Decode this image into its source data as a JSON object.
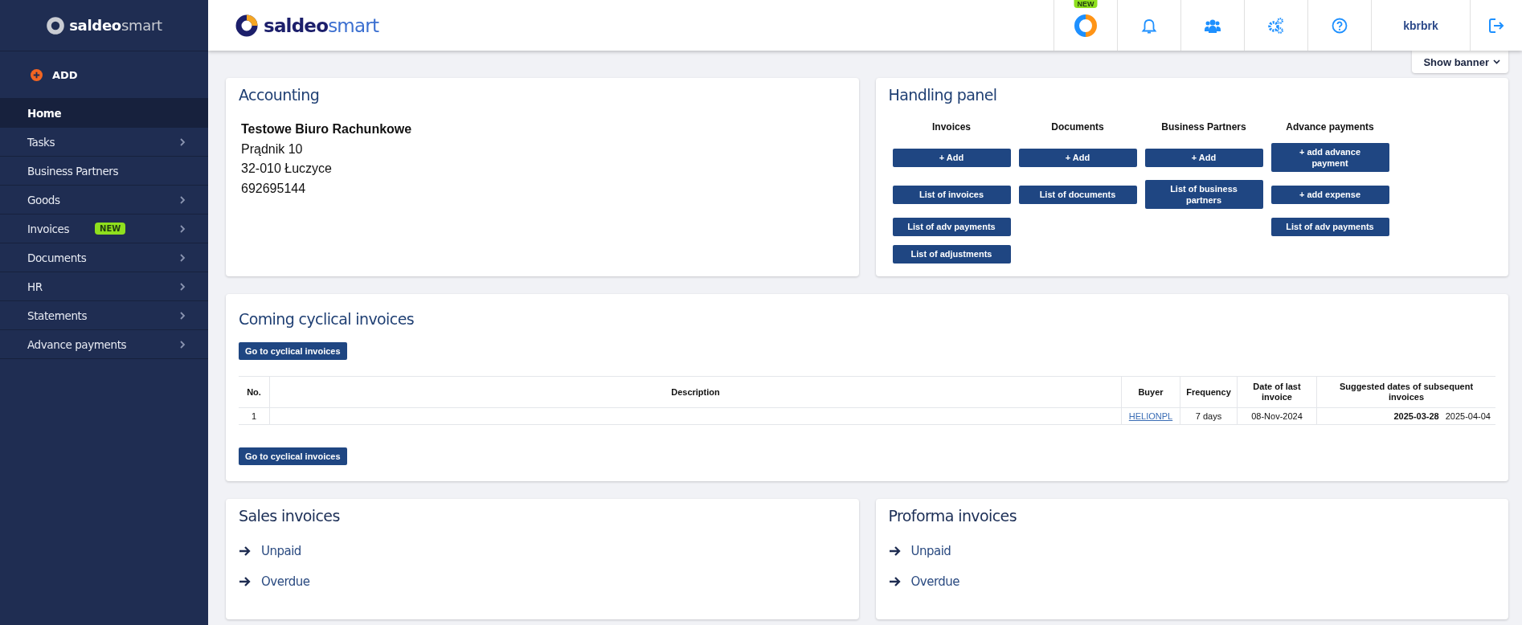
{
  "sidebar": {
    "logo": {
      "text": "saldeo",
      "accent": "smart"
    },
    "add_button": "ADD",
    "items": [
      {
        "label": "Home",
        "selected": true,
        "expandable": false
      },
      {
        "label": "Tasks",
        "selected": false,
        "expandable": true
      },
      {
        "label": "Business Partners",
        "selected": false,
        "expandable": false
      },
      {
        "label": "Goods",
        "selected": false,
        "expandable": true
      },
      {
        "label": "Invoices",
        "selected": false,
        "expandable": true,
        "badge": "NEW"
      },
      {
        "label": "Documents",
        "selected": false,
        "expandable": true
      },
      {
        "label": "HR",
        "selected": false,
        "expandable": true
      },
      {
        "label": "Statements",
        "selected": false,
        "expandable": true
      },
      {
        "label": "Advance payments",
        "selected": false,
        "expandable": true
      }
    ]
  },
  "header": {
    "logo": {
      "text": "saldeo",
      "accent": "smart"
    },
    "app_badge": "NEW",
    "user": "kbrbrk",
    "show_banner": "Show banner"
  },
  "accounting": {
    "title": "Accounting",
    "company": "Testowe Biuro Rachunkowe",
    "lines": [
      "Prądnik 10",
      "32-010 Łuczyce",
      "692695144"
    ]
  },
  "handling_panel": {
    "title": "Handling panel",
    "columns": [
      {
        "title": "Invoices",
        "buttons": [
          "+ Add",
          "List of invoices",
          "List of adv payments",
          "List of adjustments"
        ]
      },
      {
        "title": "Documents",
        "buttons": [
          "+ Add",
          "List of documents"
        ]
      },
      {
        "title": "Business Partners",
        "buttons": [
          "+ Add",
          "List of business partners"
        ]
      },
      {
        "title": "Advance payments",
        "buttons": [
          "+ add advance payment",
          "+ add expense",
          "List of adv payments"
        ]
      }
    ]
  },
  "cyclical": {
    "title": "Coming cyclical invoices",
    "top_button": "Go to cyclical invoices",
    "columns": [
      "No.",
      "Description",
      "Buyer",
      "Frequency",
      "Date of last invoice",
      "Suggested dates of subsequent invoices"
    ],
    "rows": [
      {
        "no": "1",
        "buyer": "HELIONPL",
        "frequency": "7 days",
        "last_date": "08-Nov-2024",
        "suggested": [
          {
            "date": "2025-03-28",
            "bold": true
          },
          {
            "date": "2025-04-04",
            "bold": false
          }
        ]
      }
    ],
    "bottom_button": "Go to cyclical invoices"
  },
  "sales_invoices": {
    "title": "Sales invoices",
    "links": [
      "Unpaid",
      "Overdue"
    ]
  },
  "proforma_invoices": {
    "title": "Proforma invoices",
    "links": [
      "Unpaid",
      "Overdue"
    ]
  }
}
